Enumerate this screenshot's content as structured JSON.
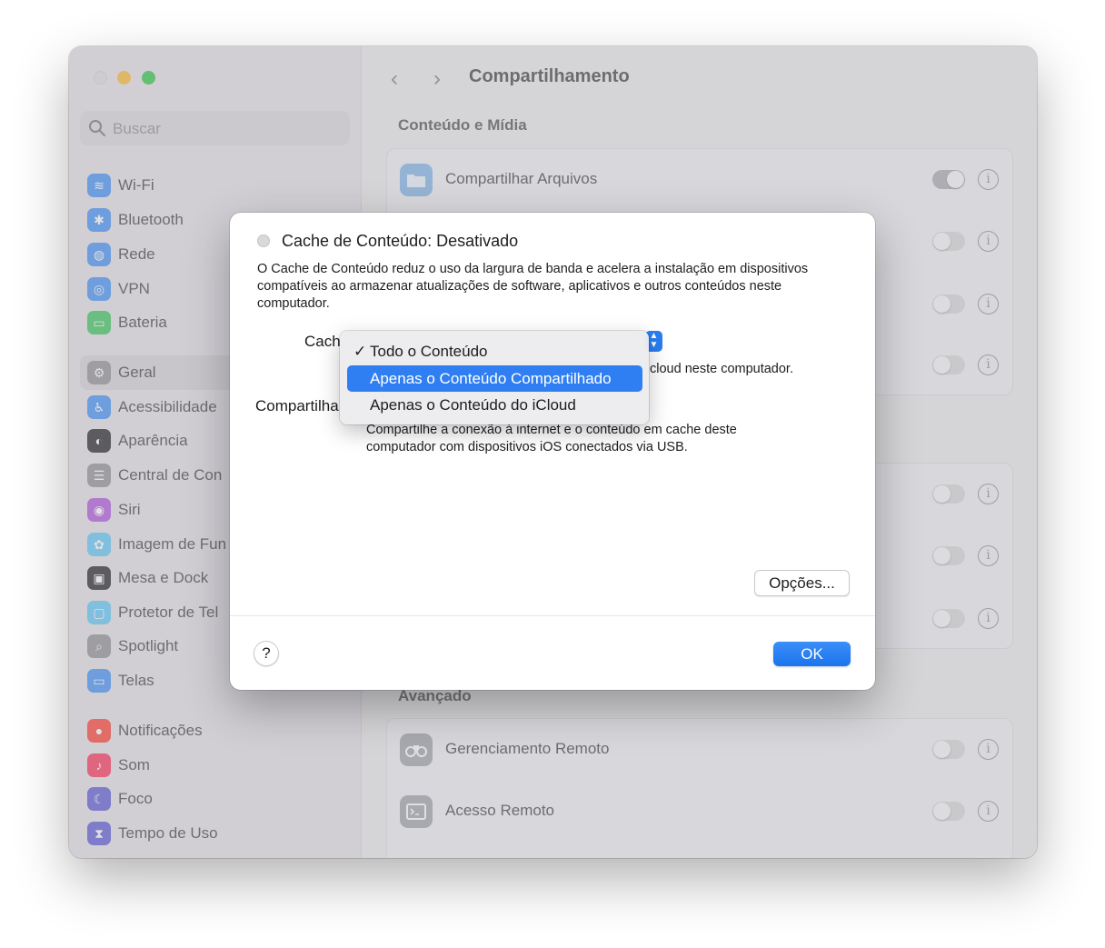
{
  "window": {
    "title": "Compartilhamento"
  },
  "sidebar": {
    "search_placeholder": "Buscar",
    "items": [
      {
        "label": "Wi-Fi",
        "icon": "wifi-icon",
        "color": "#3b8ff8"
      },
      {
        "label": "Bluetooth",
        "icon": "bluetooth-icon",
        "color": "#3b8ff8"
      },
      {
        "label": "Rede",
        "icon": "globe-icon",
        "color": "#3b8ff8"
      },
      {
        "label": "VPN",
        "icon": "vpn-icon",
        "color": "#3b8ff8"
      },
      {
        "label": "Bateria",
        "icon": "battery-icon",
        "color": "#34c759"
      },
      {
        "label": "Geral",
        "icon": "gear-icon",
        "color": "#8e8e93"
      },
      {
        "label": "Acessibilidade",
        "icon": "accessibility-icon",
        "color": "#3b8ff8"
      },
      {
        "label": "Aparência",
        "icon": "appearance-icon",
        "color": "#1d1d1f"
      },
      {
        "label": "Central de Con",
        "icon": "control-center-icon",
        "color": "#8e8e93"
      },
      {
        "label": "Siri",
        "icon": "siri-icon",
        "color": "#af52de"
      },
      {
        "label": "Imagem de Fun",
        "icon": "wallpaper-icon",
        "color": "#5ac8fa"
      },
      {
        "label": "Mesa e Dock",
        "icon": "dock-icon",
        "color": "#1d1d1f"
      },
      {
        "label": "Protetor de Tel",
        "icon": "screensaver-icon",
        "color": "#5ac8fa"
      },
      {
        "label": "Spotlight",
        "icon": "spotlight-icon",
        "color": "#8e8e93"
      },
      {
        "label": "Telas",
        "icon": "displays-icon",
        "color": "#3b8ff8"
      },
      {
        "label": "Notificações",
        "icon": "notifications-icon",
        "color": "#ff3b30"
      },
      {
        "label": "Som",
        "icon": "sound-icon",
        "color": "#ff2d55"
      },
      {
        "label": "Foco",
        "icon": "focus-icon",
        "color": "#5856d6"
      },
      {
        "label": "Tempo de Uso",
        "icon": "screen-time-icon",
        "color": "#5856d6"
      }
    ]
  },
  "main": {
    "section_media": "Conteúdo e Mídia",
    "section_advanced": "Avançado",
    "rows": [
      {
        "label": "Compartilhar Arquivos",
        "enabled": true
      },
      {
        "label": "Gerenciamento Remoto",
        "enabled": false
      },
      {
        "label": "Acesso Remoto",
        "enabled": false
      }
    ]
  },
  "dialog": {
    "title": "Cache de Conteúdo: Desativado",
    "description": "O Cache de Conteúdo reduz o uso da largura de banda e acelera a instalação em dispositivos compatíveis ao armazenar atualizações de software, aplicativos e outros conteúdos neste computador.",
    "cache_label": "Cach",
    "cache_hint": "cloud neste computador.",
    "share_label": "Compartilha",
    "share_desc": "Compartilhe a conexão à internet e o conteúdo em cache deste computador com dispositivos iOS conectados via USB.",
    "options_button": "Opções...",
    "help_button": "?",
    "ok_button": "OK"
  },
  "menu": {
    "items": [
      {
        "label": "Todo o Conteúdo",
        "checked": true
      },
      {
        "label": "Apenas o Conteúdo Compartilhado",
        "highlighted": true
      },
      {
        "label": "Apenas o Conteúdo do iCloud"
      }
    ],
    "check_mark": "✓"
  },
  "colors": {
    "accent": "#2f7ff3"
  }
}
